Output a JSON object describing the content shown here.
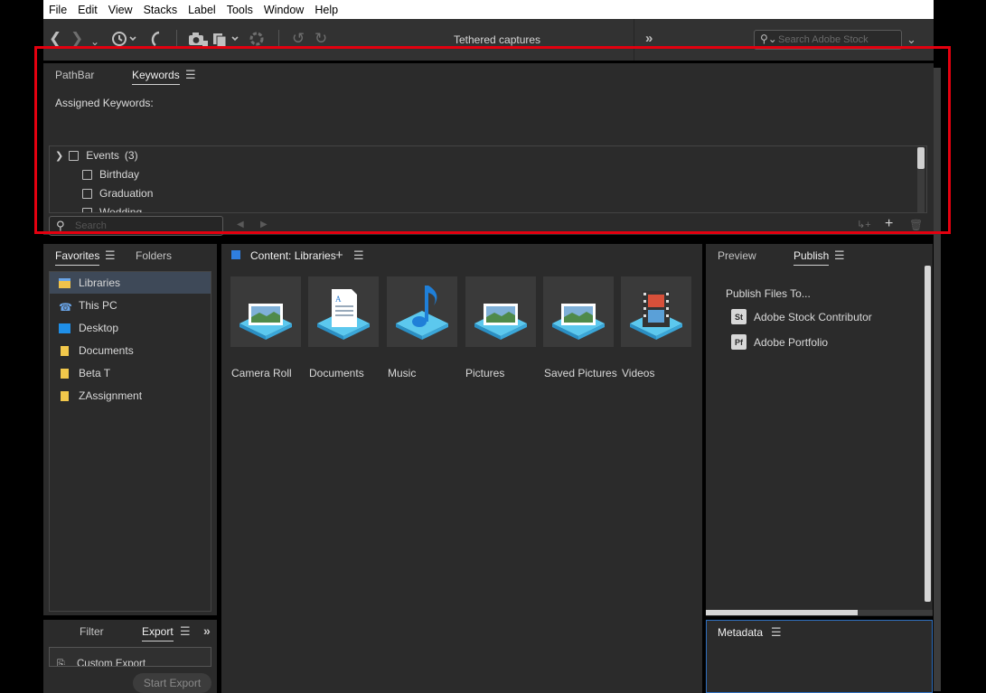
{
  "menubar": [
    "File",
    "Edit",
    "View",
    "Stacks",
    "Label",
    "Tools",
    "Window",
    "Help"
  ],
  "toolbar": {
    "title": "Tethered captures",
    "expand_label": "»",
    "stock_search_placeholder": "Search Adobe Stock"
  },
  "keywords_panel": {
    "tabs": [
      "PathBar",
      "Keywords"
    ],
    "assigned_label": "Assigned Keywords:",
    "tree": [
      {
        "label": "Events",
        "count": "(3)",
        "expanded": true,
        "level": 0
      },
      {
        "label": "Birthday",
        "level": 1
      },
      {
        "label": "Graduation",
        "level": 1
      },
      {
        "label": "Wedding",
        "level": 1
      }
    ],
    "search_placeholder": "Search"
  },
  "favorites_panel": {
    "tabs": [
      "Favorites",
      "Folders"
    ],
    "items": [
      {
        "label": "Libraries",
        "icon": "libraries-icon",
        "selected": true,
        "color": "#f0c24a"
      },
      {
        "label": "This PC",
        "icon": "pc-icon",
        "selected": false,
        "color": "#6aa5e8"
      },
      {
        "label": "Desktop",
        "icon": "desktop-icon",
        "selected": false,
        "color": "#1f8fe8"
      },
      {
        "label": "Documents",
        "icon": "folder-icon",
        "selected": false,
        "color": "#f2c84b"
      },
      {
        "label": "Beta T",
        "icon": "folder-icon",
        "selected": false,
        "color": "#f2c84b"
      },
      {
        "label": "ZAssignment",
        "icon": "folder-icon",
        "selected": false,
        "color": "#f2c84b"
      }
    ]
  },
  "export_panel": {
    "tabs": [
      "Filter",
      "Export"
    ],
    "expand_label": "»",
    "custom_export": "Custom Export",
    "start_export": "Start Export"
  },
  "content_panel": {
    "title": "Content: Libraries",
    "add_label": "+",
    "items": [
      {
        "label": "Camera Roll",
        "icon": "picture-library-icon"
      },
      {
        "label": "Documents",
        "icon": "document-library-icon"
      },
      {
        "label": "Music",
        "icon": "music-library-icon"
      },
      {
        "label": "Pictures",
        "icon": "picture-library-icon"
      },
      {
        "label": "Saved Pictures",
        "icon": "picture-library-icon"
      },
      {
        "label": "Videos",
        "icon": "video-library-icon"
      }
    ]
  },
  "publish_panel": {
    "tabs": [
      "Preview",
      "Publish"
    ],
    "heading": "Publish Files To...",
    "items": [
      {
        "badge": "St",
        "label": "Adobe Stock Contributor"
      },
      {
        "badge": "Pf",
        "label": "Adobe Portfolio"
      }
    ]
  },
  "metadata_panel": {
    "title": "Metadata"
  },
  "colors": {
    "accent": "#2f6fc0",
    "highlight_box": "#e3000f",
    "panel_bg": "#2b2b2b",
    "selection": "#3e4958"
  }
}
